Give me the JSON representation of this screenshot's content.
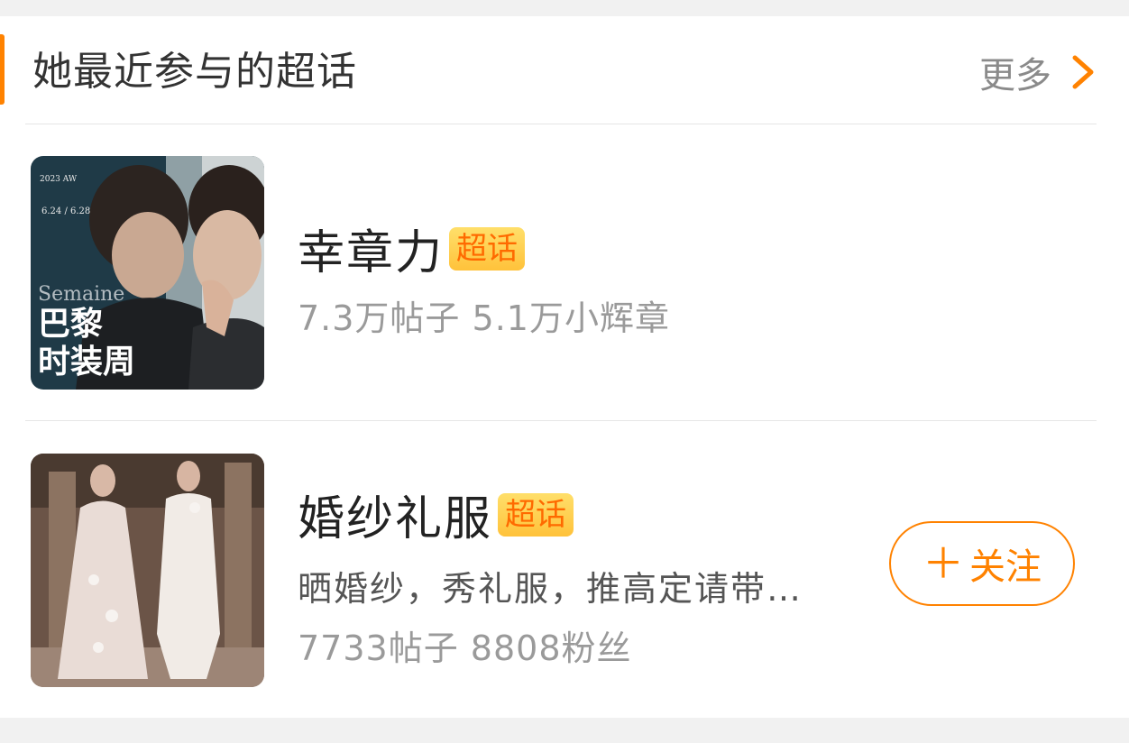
{
  "section": {
    "title": "她最近参与的超话",
    "more_label": "更多"
  },
  "topics": [
    {
      "name": "幸章力",
      "badge": "超话",
      "stats": "7.3万帖子 5.1万小辉章",
      "thumbnail": {
        "lines": [
          "巴黎",
          "时装周"
        ],
        "caption": "Semaine",
        "dates": "6.24 / 6.28"
      }
    },
    {
      "name": "婚纱礼服",
      "badge": "超话",
      "description": "晒婚纱，秀礼服，推高定请带…",
      "stats": "7733帖子 8808粉丝",
      "follow_label": "关注",
      "follow_icon": "plus-icon"
    }
  ],
  "colors": {
    "accent": "#ff8200",
    "badge_bg": "#ffcf4a",
    "badge_text": "#ff6a00",
    "page_bg": "#f1f1f1"
  }
}
